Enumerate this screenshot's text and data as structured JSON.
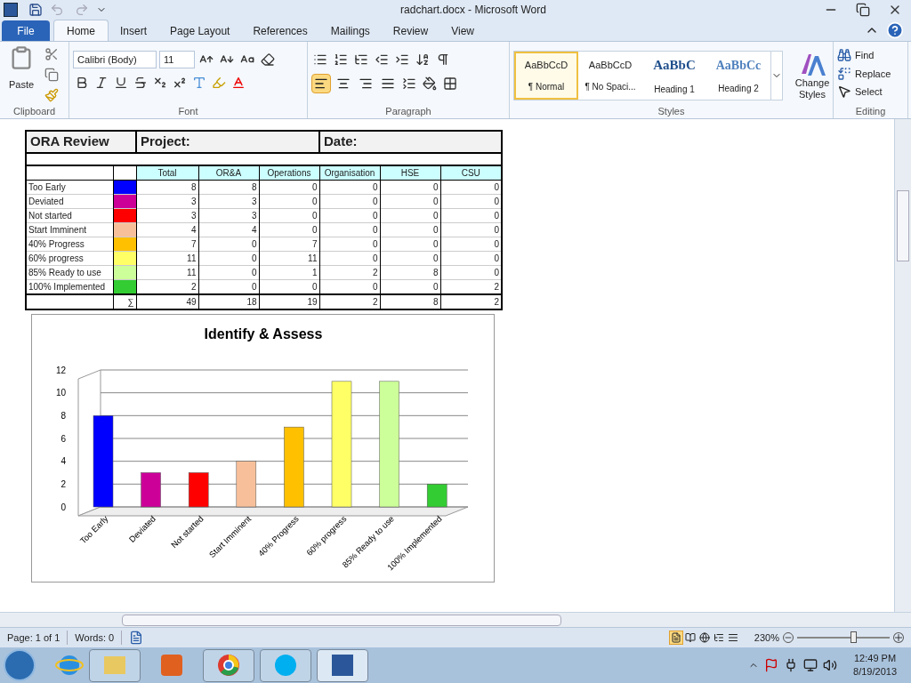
{
  "window": {
    "title": "radchart.docx - Microsoft Word"
  },
  "file_tab": "File",
  "tabs": [
    {
      "label": "Home",
      "selected": true
    },
    {
      "label": "Insert",
      "selected": false
    },
    {
      "label": "Page Layout",
      "selected": false
    },
    {
      "label": "References",
      "selected": false
    },
    {
      "label": "Mailings",
      "selected": false
    },
    {
      "label": "Review",
      "selected": false
    },
    {
      "label": "View",
      "selected": false
    }
  ],
  "clipboard": {
    "label": "Clipboard",
    "paste": "Paste"
  },
  "font": {
    "label": "Font",
    "name": "Calibri (Body)",
    "size": "11"
  },
  "paragraph": {
    "label": "Paragraph",
    "alignment": [
      {
        "kind": "left",
        "selected": true
      },
      {
        "kind": "center",
        "selected": false
      },
      {
        "kind": "right",
        "selected": false
      },
      {
        "kind": "justify",
        "selected": false
      }
    ]
  },
  "styles": {
    "label": "Styles",
    "items": [
      {
        "kind": "normal",
        "preview": "AaBbCcD",
        "name": "¶ Normal",
        "selected": true
      },
      {
        "kind": "normal",
        "preview": "AaBbCcD",
        "name": "¶ No Spaci...",
        "selected": false
      },
      {
        "kind": "heading1",
        "preview": "AaBbC",
        "name": "Heading 1",
        "selected": false
      },
      {
        "kind": "heading2",
        "preview": "AaBbCc",
        "name": "Heading 2",
        "selected": false
      }
    ],
    "change": "Change Styles"
  },
  "editing": {
    "label": "Editing",
    "find": "Find",
    "replace": "Replace",
    "select": "Select"
  },
  "table": {
    "title": "ORA Review",
    "project": "Project:",
    "date": "Date:",
    "columns": [
      "Total",
      "OR&A",
      "Operations",
      "Organisation",
      "HSE",
      "CSU"
    ],
    "rows": [
      {
        "label": "Too Early",
        "color": "#0000ff",
        "values": [
          "8",
          "8",
          "0",
          "0",
          "0",
          "0"
        ]
      },
      {
        "label": "Deviated",
        "color": "#cc0099",
        "values": [
          "3",
          "3",
          "0",
          "0",
          "0",
          "0"
        ]
      },
      {
        "label": "Not started",
        "color": "#ff0000",
        "values": [
          "3",
          "3",
          "0",
          "0",
          "0",
          "0"
        ]
      },
      {
        "label": "Start Imminent",
        "color": "#f8c09a",
        "values": [
          "4",
          "4",
          "0",
          "0",
          "0",
          "0"
        ]
      },
      {
        "label": "40% Progress",
        "color": "#ffc000",
        "values": [
          "7",
          "0",
          "7",
          "0",
          "0",
          "0"
        ]
      },
      {
        "label": "60% progress",
        "color": "#ffff66",
        "values": [
          "11",
          "0",
          "11",
          "0",
          "0",
          "0"
        ]
      },
      {
        "label": "85% Ready to use",
        "color": "#ccff99",
        "values": [
          "11",
          "0",
          "1",
          "2",
          "8",
          "0"
        ]
      },
      {
        "label": "100% Implemented",
        "color": "#33cc33",
        "values": [
          "2",
          "0",
          "0",
          "0",
          "0",
          "2"
        ]
      }
    ],
    "sum": {
      "symbol": "∑",
      "values": [
        "49",
        "18",
        "19",
        "2",
        "8",
        "2"
      ]
    }
  },
  "chart_data": {
    "type": "bar",
    "title": "Identify & Assess",
    "categories": [
      "Too Early",
      "Deviated",
      "Not started",
      "Start Imminent",
      "40% Progress",
      "60% progress",
      "85% Ready to use",
      "100% Implemented"
    ],
    "values": [
      8,
      3,
      3,
      4,
      7,
      11,
      11,
      2
    ],
    "ylim": [
      0,
      12
    ],
    "yticks": [
      0,
      2,
      4,
      6,
      8,
      10,
      12
    ],
    "grid": true
  },
  "status_bar": {
    "page": "Page: 1 of 1",
    "words": "Words: 0",
    "views": [
      {
        "kind": "print",
        "selected": true
      },
      {
        "kind": "reading",
        "selected": false
      },
      {
        "kind": "web",
        "selected": false
      },
      {
        "kind": "outline",
        "selected": false
      },
      {
        "kind": "draft",
        "selected": false
      }
    ],
    "zoom": "230%",
    "zoom_level": {
      "level": 0.62
    }
  },
  "taskbar": {
    "time": "12:49 PM",
    "date": "8/19/2013"
  }
}
